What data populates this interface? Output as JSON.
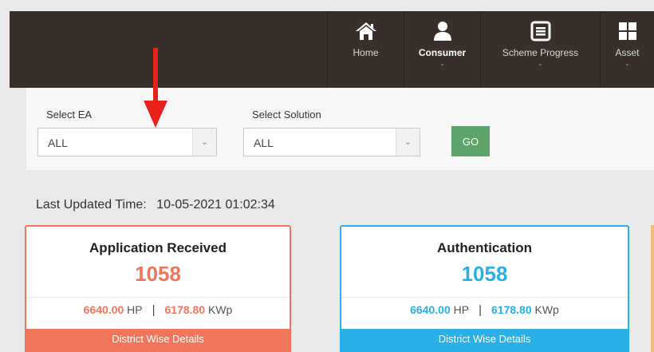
{
  "nav": {
    "items": [
      {
        "label": "Home",
        "icon": "home-icon",
        "active": false,
        "caret": ""
      },
      {
        "label": "Consumer",
        "icon": "user-icon",
        "active": true,
        "caret": "⌄"
      },
      {
        "label": "Scheme Progress",
        "icon": "list-icon",
        "active": false,
        "caret": "⌄"
      },
      {
        "label": "Asset",
        "icon": "grid-icon",
        "active": false,
        "caret": "⌄"
      }
    ]
  },
  "filters": {
    "ea_label": "Select EA",
    "ea_value": "ALL",
    "solution_label": "Select Solution",
    "solution_value": "ALL",
    "go_label": "GO"
  },
  "last_updated": {
    "label": "Last Updated Time:",
    "value": "10-05-2021 01:02:34"
  },
  "cards": [
    {
      "title": "Application Received",
      "count": "1058",
      "hp_value": "6640.00",
      "hp_unit": "HP",
      "kwp_value": "6178.80",
      "kwp_unit": "KWp",
      "footer": "District Wise Details",
      "color": "#f0755a"
    },
    {
      "title": "Authentication",
      "count": "1058",
      "hp_value": "6640.00",
      "hp_unit": "HP",
      "kwp_value": "6178.80",
      "kwp_unit": "KWp",
      "footer": "District Wise Details",
      "color": "#29b0e6"
    }
  ],
  "colors": {
    "nav_bg": "#382f2b",
    "go_button": "#5da36a",
    "annotation_arrow": "#e8211b"
  }
}
